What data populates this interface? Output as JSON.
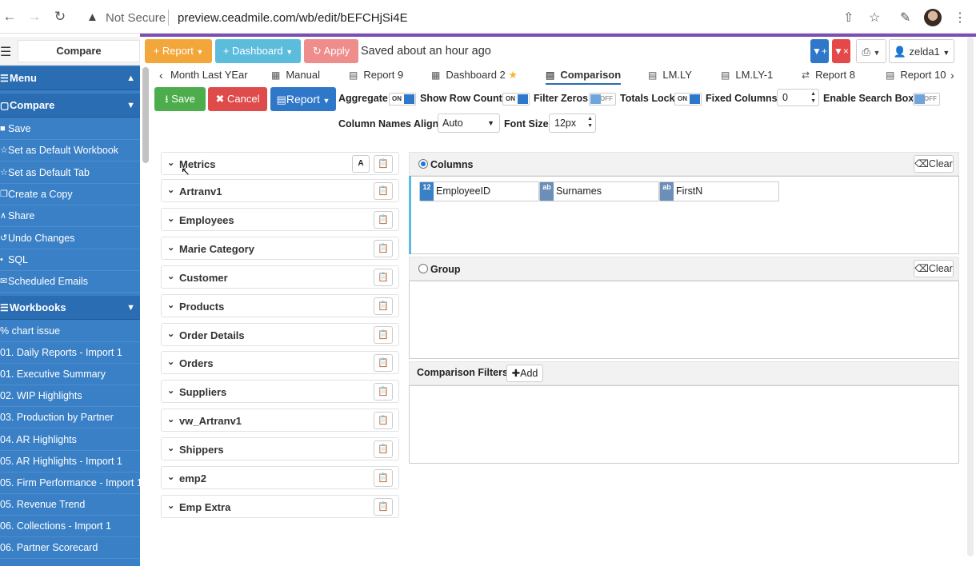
{
  "browser": {
    "security": "Not Secure",
    "url": "preview.ceadmile.com/wb/edit/bEFCHjSi4E"
  },
  "sidebar": {
    "title": "Compare",
    "menu_label": "Menu",
    "compare_label": "Compare",
    "compare_items": [
      {
        "label": "Save",
        "icon": "save-icon"
      },
      {
        "label": "Set as Default Workbook",
        "icon": "star-icon"
      },
      {
        "label": "Set as Default Tab",
        "icon": "star-icon"
      },
      {
        "label": "Create a Copy",
        "icon": "copy-icon"
      },
      {
        "label": "Share",
        "icon": "share-icon"
      },
      {
        "label": "Undo Changes",
        "icon": "undo-icon"
      },
      {
        "label": "SQL",
        "icon": "code-icon"
      },
      {
        "label": "Scheduled Emails",
        "icon": "mail-icon"
      }
    ],
    "workbooks_label": "Workbooks",
    "workbooks": [
      "% chart issue",
      "01. Daily Reports - Import 1",
      "01. Executive Summary",
      "02. WIP Highlights",
      "03. Production by Partner",
      "04. AR Highlights",
      "05. AR Highlights - Import 1",
      "05. Firm Performance - Import 1",
      "05. Revenue Trend",
      "06. Collections - Import 1",
      "06. Partner Scorecard"
    ]
  },
  "actions": {
    "report": "Report",
    "dashboard": "Dashboard",
    "apply": "Apply",
    "saved_status": "Saved about an hour ago",
    "user": "zelda1"
  },
  "tabs": [
    {
      "label": "Month Last YEar",
      "icon": ""
    },
    {
      "label": "Manual",
      "icon": "dashboard-icon"
    },
    {
      "label": "Report 9",
      "icon": "report-icon"
    },
    {
      "label": "Dashboard 2",
      "icon": "dashboard-icon"
    },
    {
      "label": "Comparison",
      "icon": "report-icon"
    },
    {
      "label": "LM.LY",
      "icon": "report-icon"
    },
    {
      "label": "LM.LY-1",
      "icon": "report-icon"
    },
    {
      "label": "Report 8",
      "icon": "pivot-icon"
    },
    {
      "label": "Report 10",
      "icon": "report-icon"
    }
  ],
  "toolbar": {
    "save": "Save",
    "cancel": "Cancel",
    "report": "Report",
    "aggregate": "Aggregate",
    "show_row_count": "Show Row Count",
    "filter_zeros": "Filter Zeros",
    "totals_lock": "Totals Lock",
    "fixed_columns": "Fixed Columns",
    "fixed_columns_value": "0",
    "enable_search_box": "Enable Search Box",
    "toggle_on": "ON",
    "toggle_off": "OFF",
    "column_names_align": "Column Names Align",
    "column_names_align_value": "Auto",
    "font_size": "Font Size",
    "font_size_value": "12px"
  },
  "categories": [
    "Metrics",
    "Artranv1",
    "Employees",
    "Marie Category",
    "Customer",
    "Products",
    "Order Details",
    "Orders",
    "Suppliers",
    "vw_Artranv1",
    "Shippers",
    "emp2",
    "Emp Extra"
  ],
  "zones": {
    "columns_label": "Columns",
    "group_label": "Group",
    "clear": "Clear",
    "columns": [
      {
        "type": "12",
        "name": "EmployeeID"
      },
      {
        "type": "ab",
        "name": "Surnames"
      },
      {
        "type": "ab",
        "name": "FirstN"
      }
    ],
    "comparison_filters": "Comparison Filters",
    "add": "Add"
  }
}
